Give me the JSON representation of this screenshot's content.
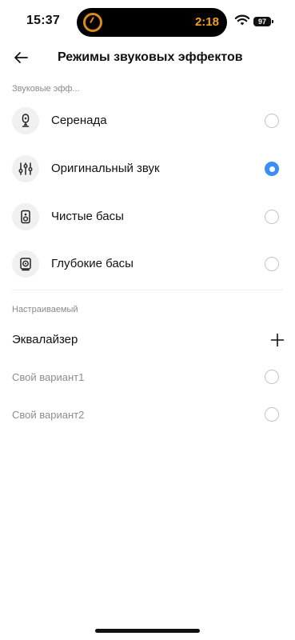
{
  "status_bar": {
    "time": "15:37",
    "timer": "2:18",
    "battery": "97"
  },
  "header": {
    "title": "Режимы звуковых эффектов"
  },
  "sections": {
    "effects_label": "Звуковые эфф...",
    "custom_label": "Настраиваемый"
  },
  "effects": [
    {
      "label": "Серенада",
      "icon": "microphone-icon",
      "selected": false
    },
    {
      "label": "Оригинальный звук",
      "icon": "sliders-icon",
      "selected": true
    },
    {
      "label": "Чистые басы",
      "icon": "speaker-icon",
      "selected": false
    },
    {
      "label": "Глубокие басы",
      "icon": "subwoofer-icon",
      "selected": false
    }
  ],
  "equalizer": {
    "label": "Эквалайзер",
    "add_icon": "plus-icon"
  },
  "custom_presets": [
    {
      "label": "Свой вариант1",
      "selected": false
    },
    {
      "label": "Свой вариант2",
      "selected": false
    }
  ],
  "colors": {
    "accent": "#3a8ef5",
    "timer": "#f0a020",
    "secondary_text": "#8a8a8a"
  }
}
